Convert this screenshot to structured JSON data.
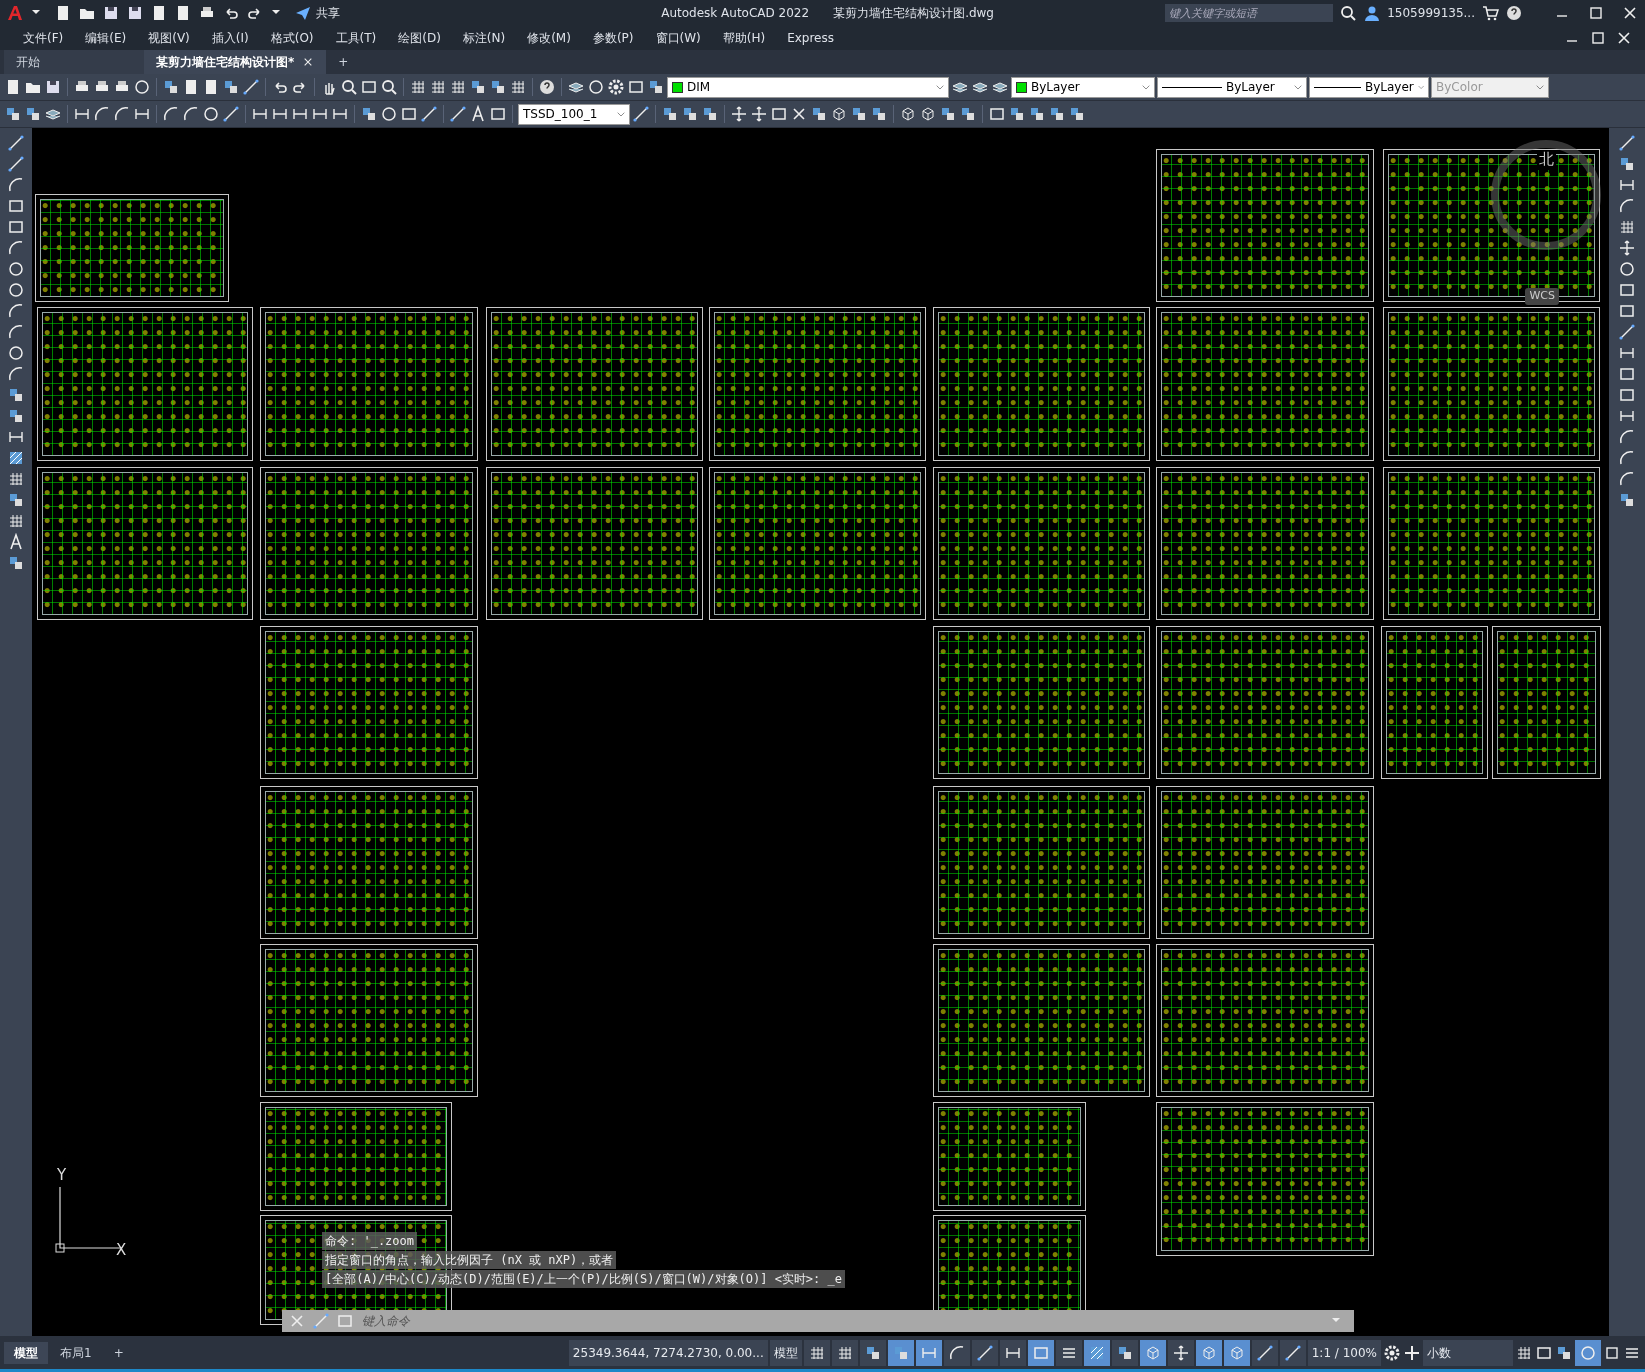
{
  "title_bar": {
    "share": "共享",
    "title": "Autodesk AutoCAD 2022",
    "file": "某剪力墙住宅结构设计图.dwg",
    "search": {
      "placeholder": "键入关键字或短语"
    },
    "user": "1505999135..."
  },
  "menu": [
    "文件(F)",
    "编辑(E)",
    "视图(V)",
    "插入(I)",
    "格式(O)",
    "工具(T)",
    "绘图(D)",
    "标注(N)",
    "修改(M)",
    "参数(P)",
    "窗口(W)",
    "帮助(H)",
    "Express"
  ],
  "file_tabs": [
    {
      "label": "开始",
      "selected": false,
      "closable": false
    },
    {
      "label": "某剪力墙住宅结构设计图*",
      "selected": true,
      "closable": true
    }
  ],
  "new_tab": "+",
  "properties": {
    "layer": "DIM",
    "color_control": "ByLayer",
    "linetype": "ByLayer",
    "lineweight": "ByLayer",
    "plot_style": {
      "value": "ByColor",
      "disabled": true
    },
    "text_style": "TSSD_100_1"
  },
  "viewcube": {
    "north": "北",
    "ucs": "WCS"
  },
  "ucs_icon": {
    "y": "Y",
    "x": "X"
  },
  "command_line": {
    "history": [
      "命令: '_.zoom",
      "指定窗口的角点，输入比例因子 (nX 或 nXP)，或者",
      "[全部(A)/中心(C)/动态(D)/范围(E)/上一个(P)/比例(S)/窗口(W)/对象(O)] <实时>: _e"
    ],
    "placeholder": "键入命令"
  },
  "layout_tabs": [
    {
      "label": "模型",
      "selected": true
    },
    {
      "label": "布局1",
      "selected": false
    }
  ],
  "new_layout": "+",
  "status_bar": {
    "coordinates": "25349.3644, 7274.2730, 0.00...",
    "space": "模型",
    "toggles": [
      {
        "on": false
      },
      {
        "on": false
      },
      {
        "on": false
      },
      {
        "on": true
      },
      {
        "on": true
      },
      {
        "on": false
      },
      {
        "on": false
      },
      {
        "on": false
      },
      {
        "on": true
      },
      {
        "on": false
      },
      {
        "on": true
      },
      {
        "on": false
      },
      {
        "on": true
      },
      {
        "on": false
      },
      {
        "on": true
      },
      {
        "on": true
      },
      {
        "on": false
      },
      {
        "on": false
      }
    ],
    "scale": "1:1 / 100%",
    "units": "小数",
    "hardware_acceleration": {
      "on": true
    }
  }
}
